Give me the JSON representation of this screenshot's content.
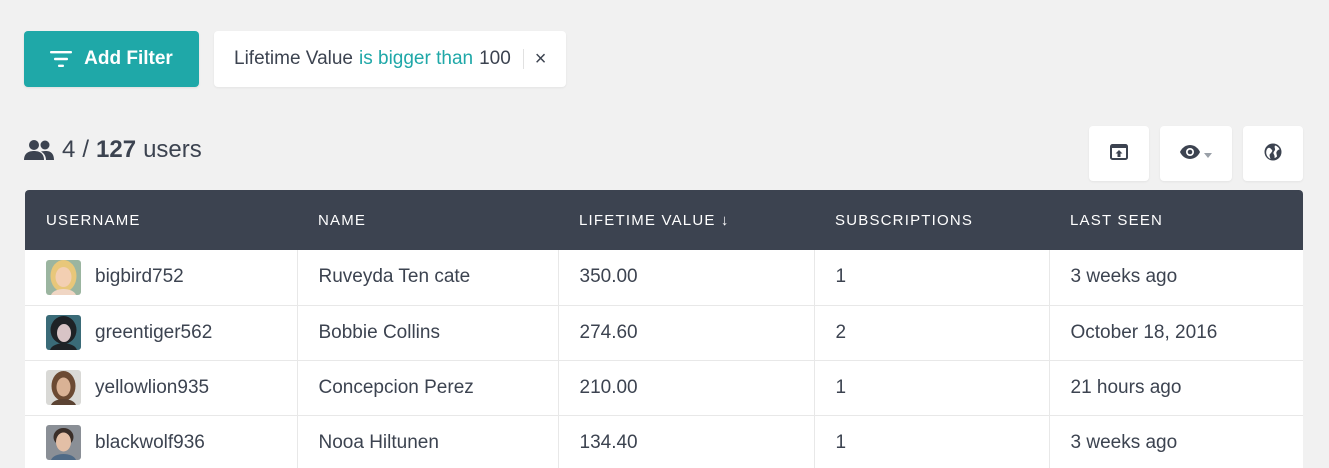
{
  "filter_bar": {
    "add_filter_label": "Add Filter",
    "active_filter": {
      "field": "Lifetime Value",
      "operator": "is bigger than",
      "value": "100",
      "remove_symbol": "×"
    }
  },
  "summary": {
    "shown": "4",
    "separator": "/",
    "total": "127",
    "unit": "users"
  },
  "toolbar": {
    "icons": [
      "export-icon",
      "eye-icon",
      "globe-icon"
    ]
  },
  "table": {
    "columns": [
      "USERNAME",
      "NAME",
      "LIFETIME VALUE ↓",
      "SUBSCRIPTIONS",
      "LAST SEEN"
    ],
    "rows": [
      {
        "username": "bigbird752",
        "name": "Ruveyda Ten cate",
        "lifetime_value": "350.00",
        "subscriptions": "1",
        "last_seen": "3 weeks ago"
      },
      {
        "username": "greentiger562",
        "name": "Bobbie Collins",
        "lifetime_value": "274.60",
        "subscriptions": "2",
        "last_seen": "October 18, 2016"
      },
      {
        "username": "yellowlion935",
        "name": "Concepcion Perez",
        "lifetime_value": "210.00",
        "subscriptions": "1",
        "last_seen": "21 hours ago"
      },
      {
        "username": "blackwolf936",
        "name": "Nooa Hiltunen",
        "lifetime_value": "134.40",
        "subscriptions": "1",
        "last_seen": "3 weeks ago"
      }
    ]
  },
  "colors": {
    "accent": "#1fa8a8",
    "header_bg": "#3c4350",
    "page_bg": "#f1f1f1"
  }
}
